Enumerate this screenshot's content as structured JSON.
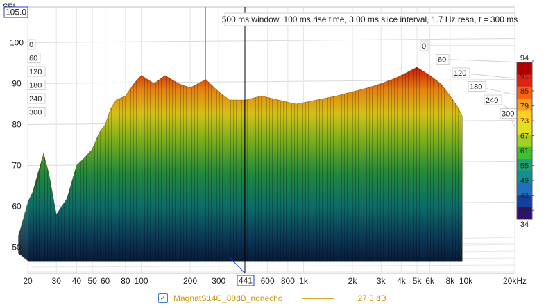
{
  "chart_data": {
    "type": "waterfall-3d",
    "title": "500 ms window, 100 ms rise time, 3.00 ms slice interval, 1.7 Hz resn, t = 300 ms",
    "ylabel": "SPL",
    "ylim": [
      45,
      105
    ],
    "y_ticks": [
      "50",
      "60",
      "70",
      "80",
      "90",
      "100"
    ],
    "cursor_y_value": "105.0",
    "x_scale": "log",
    "xlim": [
      20,
      20000
    ],
    "x_ticks": [
      {
        "v": 20,
        "t": "20"
      },
      {
        "v": 30,
        "t": "30"
      },
      {
        "v": 40,
        "t": "40"
      },
      {
        "v": 50,
        "t": "50"
      },
      {
        "v": 60,
        "t": "60"
      },
      {
        "v": 80,
        "t": "80"
      },
      {
        "v": 100,
        "t": "100"
      },
      {
        "v": 200,
        "t": "200"
      },
      {
        "v": 300,
        "t": "300"
      },
      {
        "v": 400,
        "t": "4"
      },
      {
        "v": 600,
        "t": "600"
      },
      {
        "v": 800,
        "t": "800"
      },
      {
        "v": 1000,
        "t": "1k"
      },
      {
        "v": 2000,
        "t": "2k"
      },
      {
        "v": 3000,
        "t": "3k"
      },
      {
        "v": 4000,
        "t": "4k"
      },
      {
        "v": 5000,
        "t": "5k"
      },
      {
        "v": 6000,
        "t": "6k"
      },
      {
        "v": 8000,
        "t": "8k"
      },
      {
        "v": 10000,
        "t": "10k"
      },
      {
        "v": 20000,
        "t": "20kHz"
      }
    ],
    "cursor_x_value": "441",
    "time_axis_ticks": [
      "0",
      "60",
      "120",
      "180",
      "240",
      "300"
    ],
    "colorbar": {
      "ticks": [
        "94",
        "91",
        "85",
        "79",
        "73",
        "67",
        "61",
        "55",
        "49",
        "43",
        "37",
        "34"
      ],
      "colors": [
        "#b00000",
        "#e02010",
        "#ff6010",
        "#ffa020",
        "#ffd020",
        "#e0e020",
        "#a0d020",
        "#40c030",
        "#20a070",
        "#109090",
        "#2070c0",
        "#1040a0",
        "#301070"
      ]
    },
    "front_slice": [
      [
        20,
        61
      ],
      [
        23,
        66
      ],
      [
        25,
        73
      ],
      [
        27,
        68
      ],
      [
        30,
        58
      ],
      [
        35,
        62
      ],
      [
        40,
        70
      ],
      [
        45,
        72
      ],
      [
        50,
        74
      ],
      [
        55,
        78
      ],
      [
        60,
        80
      ],
      [
        65,
        84
      ],
      [
        70,
        86
      ],
      [
        80,
        87
      ],
      [
        90,
        90
      ],
      [
        100,
        92
      ],
      [
        120,
        90
      ],
      [
        140,
        92
      ],
      [
        170,
        90
      ],
      [
        200,
        89
      ],
      [
        250,
        91
      ],
      [
        300,
        88
      ],
      [
        350,
        86
      ],
      [
        441,
        86
      ],
      [
        550,
        87
      ],
      [
        700,
        86
      ],
      [
        900,
        85
      ],
      [
        1200,
        86
      ],
      [
        1600,
        87
      ],
      [
        2000,
        88
      ],
      [
        2500,
        89
      ],
      [
        3000,
        90
      ],
      [
        3500,
        91
      ],
      [
        4000,
        92
      ],
      [
        5000,
        94
      ],
      [
        6000,
        92
      ],
      [
        7000,
        90
      ],
      [
        8000,
        87
      ],
      [
        9000,
        84
      ],
      [
        9500,
        82
      ]
    ],
    "floor_db": 48,
    "series": [
      {
        "name": "MagnatS14C_88dB_nonecho",
        "value": "27.3 dB"
      }
    ]
  },
  "legend": {
    "checked": "✓",
    "name": "MagnatS14C_88dB_nonecho",
    "value": "27.3 dB"
  }
}
